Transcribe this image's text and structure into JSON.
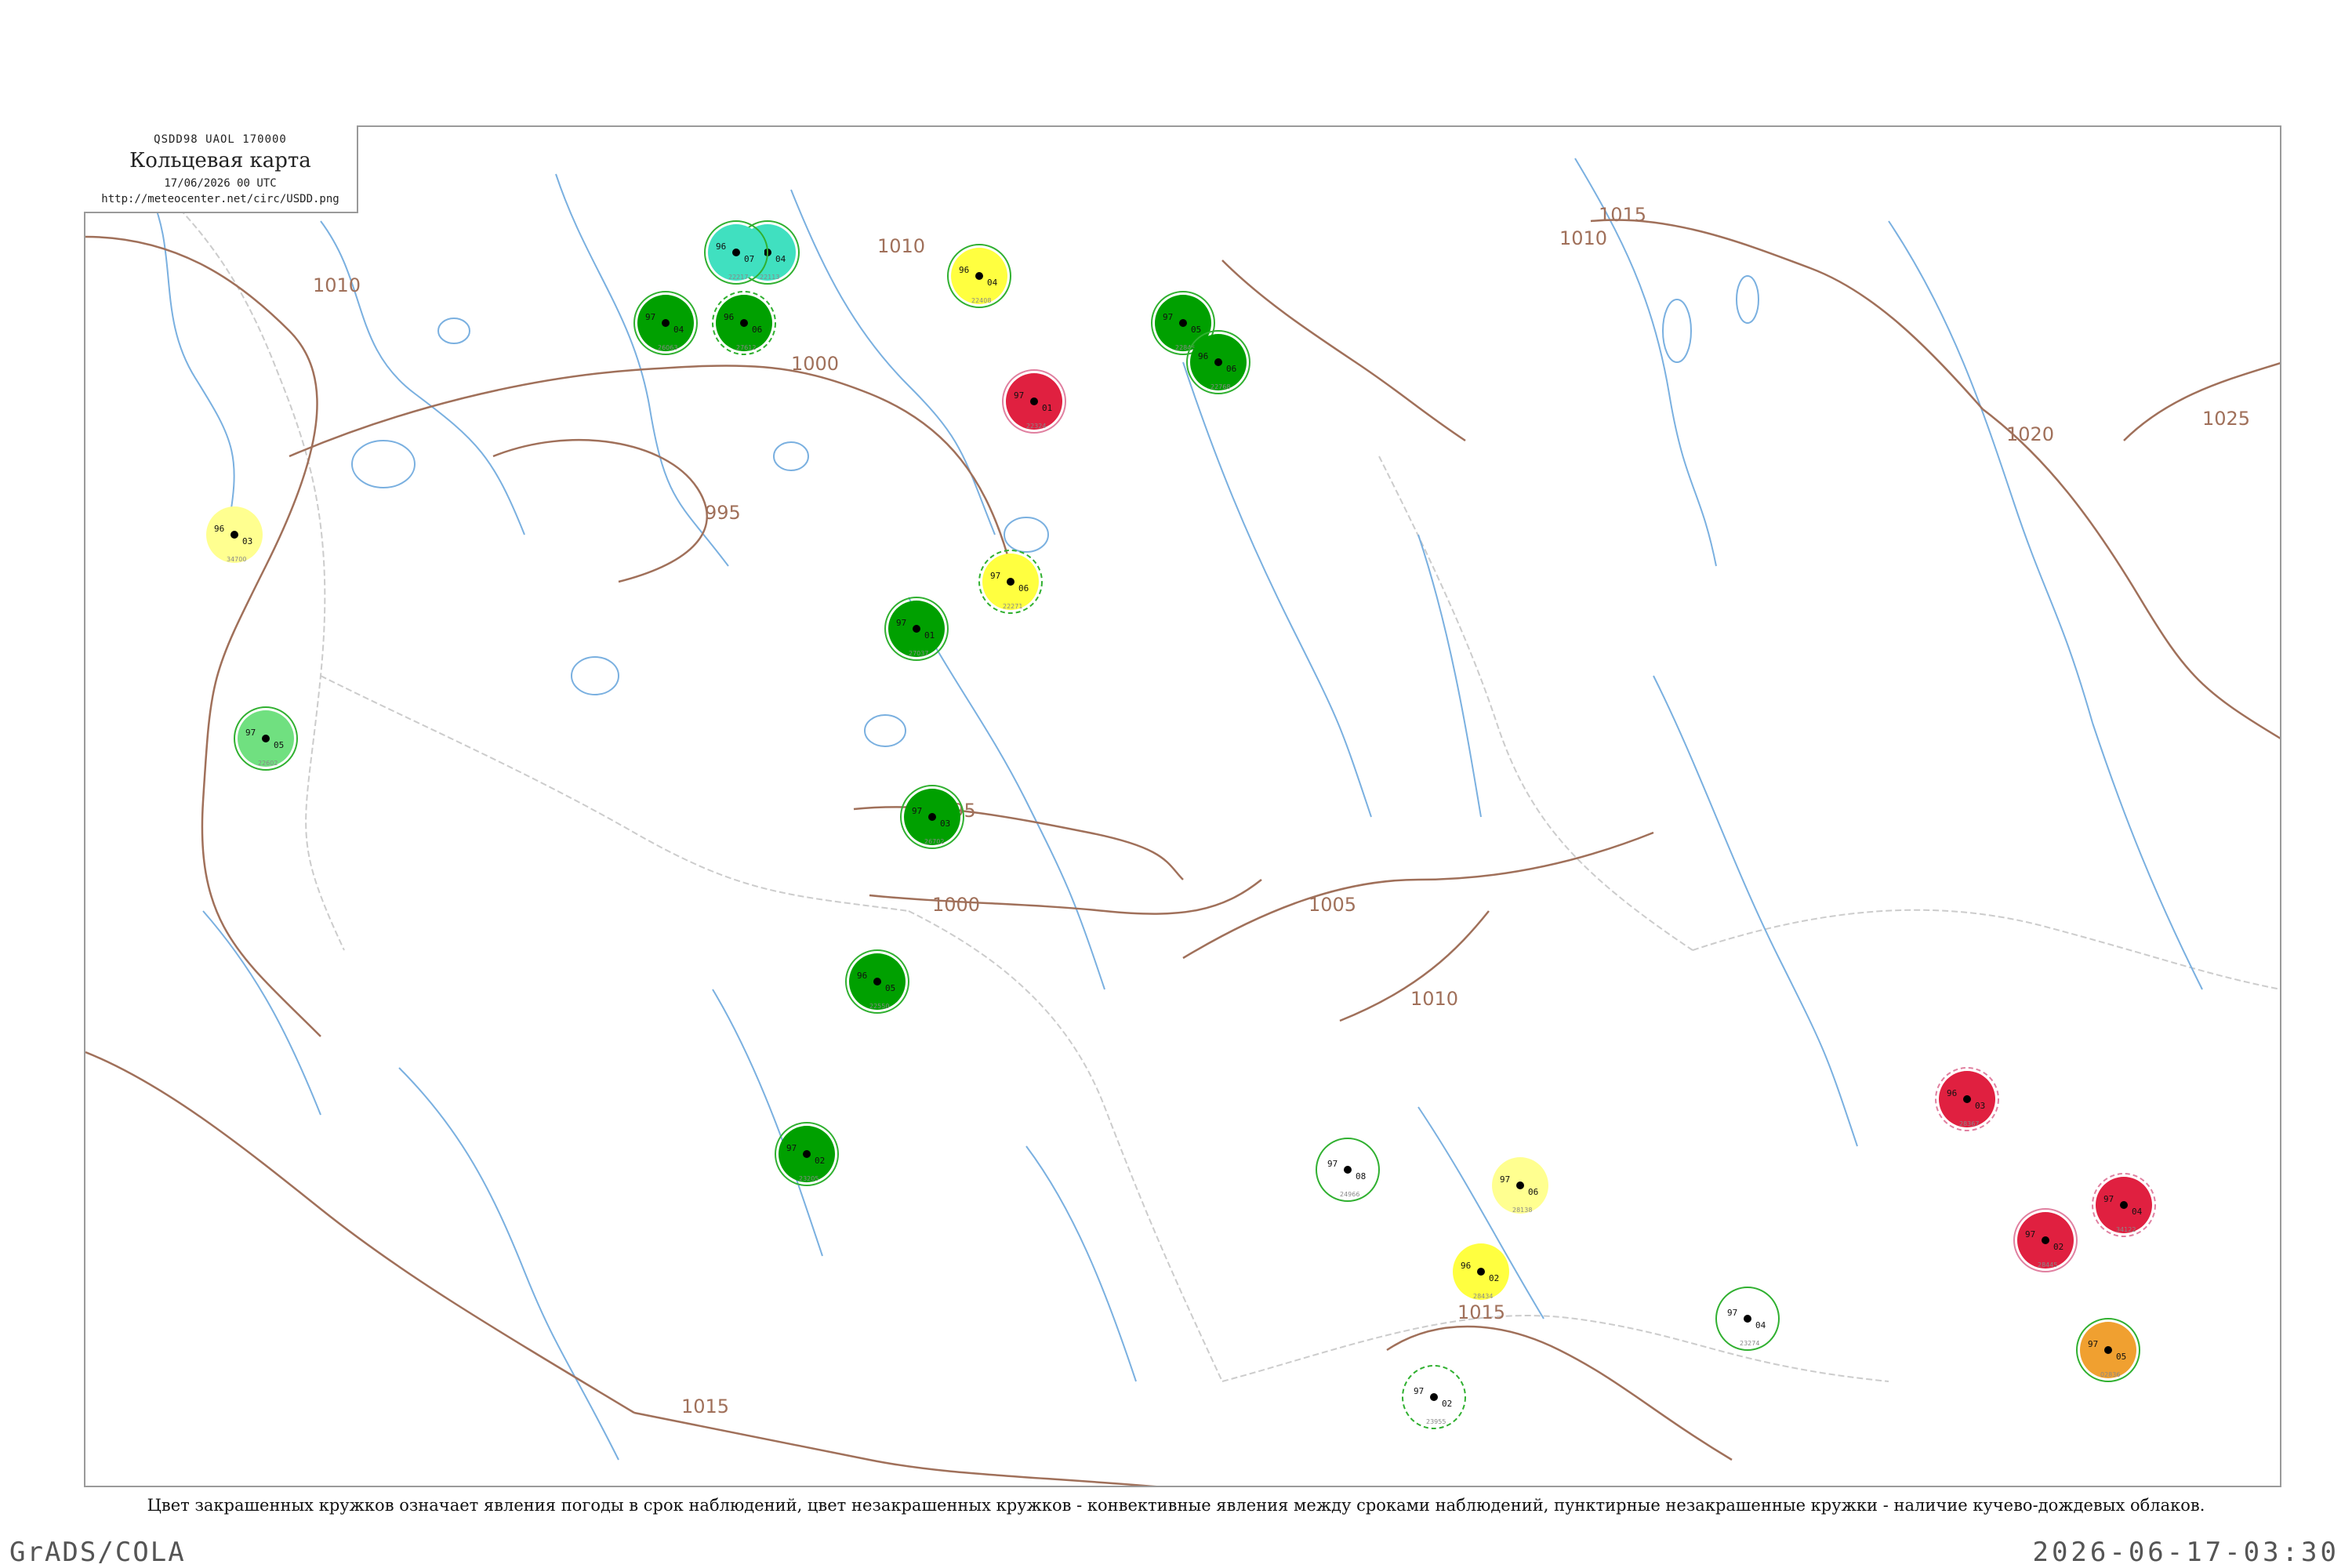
{
  "header": {
    "code": "QSDD98  UAOL  170000",
    "title": "Кольцевая карта",
    "date": "17/06/2026 00 UTC",
    "url": "http://meteocenter.net/circ/USDD.png"
  },
  "caption": "Цвет закрашенных кружков означает явления погоды в срок наблюдений, цвет незакрашенных кружков - конвективные явления между сроками наблюдений, пунктирные незакрашенные кружки - наличие кучево-дождевых облаков.",
  "footer": {
    "left": "GrADS/COLA",
    "right": "2026-06-17-03:30"
  },
  "colors": {
    "isobar": "#a0705a",
    "river": "#7ab0e0",
    "border": "#cccccc",
    "green": "#00a000",
    "teal": "#40e0c0",
    "yellow": "#ffff40",
    "yellow_pale": "#ffff90",
    "red": "#e02040",
    "orange": "#f0a030",
    "light_green": "#70e080"
  },
  "isobars": [
    {
      "label": "1010"
    },
    {
      "label": "1000"
    },
    {
      "label": "995"
    },
    {
      "label": "995"
    },
    {
      "label": "1000"
    },
    {
      "label": "1005"
    },
    {
      "label": "1010"
    },
    {
      "label": "1010"
    },
    {
      "label": "1015"
    },
    {
      "label": "1020"
    },
    {
      "label": "1025"
    },
    {
      "label": "1015"
    },
    {
      "label": "1015"
    },
    {
      "label": "1010"
    }
  ],
  "stations": [
    {
      "fill": "green",
      "ring": "solid",
      "v1": "97",
      "v2": "04",
      "name": "26063"
    },
    {
      "fill": "green",
      "ring": "dashed",
      "v1": "96",
      "v2": "06",
      "name": "27612"
    },
    {
      "fill": "green",
      "ring": "solid",
      "v1": "97",
      "v2": "05",
      "name": "22845"
    },
    {
      "fill": "green",
      "ring": "solid",
      "v1": "96",
      "v2": "06",
      "name": "22768"
    },
    {
      "fill": "green",
      "ring": "solid",
      "v1": "97",
      "v2": "01",
      "name": "27037"
    },
    {
      "fill": "green",
      "ring": "solid",
      "v1": "97",
      "v2": "03",
      "name": "26702"
    },
    {
      "fill": "green",
      "ring": "solid",
      "v1": "96",
      "v2": "05",
      "name": "22550"
    },
    {
      "fill": "green",
      "ring": "solid",
      "v1": "97",
      "v2": "02",
      "name": "23205"
    },
    {
      "fill": "teal",
      "ring": "solid",
      "v1": "97",
      "v2": "04",
      "name": "22113"
    },
    {
      "fill": "teal",
      "ring": "solid",
      "v1": "96",
      "v2": "07",
      "name": "22217"
    },
    {
      "fill": "light_green",
      "ring": "solid",
      "v1": "97",
      "v2": "05",
      "name": "22602"
    },
    {
      "fill": "yellow",
      "ring": "solid",
      "v1": "96",
      "v2": "04",
      "name": "22408"
    },
    {
      "fill": "yellow",
      "ring": "dashed",
      "v1": "97",
      "v2": "06",
      "name": "22271"
    },
    {
      "fill": "red",
      "ring": "solid",
      "v1": "97",
      "v2": "01",
      "name": "22324"
    },
    {
      "fill": "red",
      "ring": "dashed",
      "v1": "96",
      "v2": "03",
      "name": "28367"
    },
    {
      "fill": "red",
      "ring": "solid",
      "v1": "97",
      "v2": "02",
      "name": "28445"
    },
    {
      "fill": "red",
      "ring": "dashed",
      "v1": "97",
      "v2": "04",
      "name": "34122"
    },
    {
      "fill": "orange",
      "ring": "solid",
      "v1": "97",
      "v2": "05",
      "name": "02836"
    },
    {
      "fill": "yellow_pale",
      "ring": "none",
      "v1": "96",
      "v2": "03",
      "name": "34700"
    },
    {
      "fill": "yellow_pale",
      "ring": "none",
      "v1": "97",
      "v2": "06",
      "name": "28138"
    },
    {
      "fill": "yellow",
      "ring": "none",
      "v1": "96",
      "v2": "02",
      "name": "28434"
    },
    {
      "fill": "none",
      "ring": "solid",
      "v1": "97",
      "v2": "04",
      "name": "23274"
    },
    {
      "fill": "none",
      "ring": "dashed",
      "v1": "97",
      "v2": "02",
      "name": "23955"
    },
    {
      "fill": "none",
      "ring": "solid",
      "v1": "97",
      "v2": "08",
      "name": "24966"
    }
  ]
}
